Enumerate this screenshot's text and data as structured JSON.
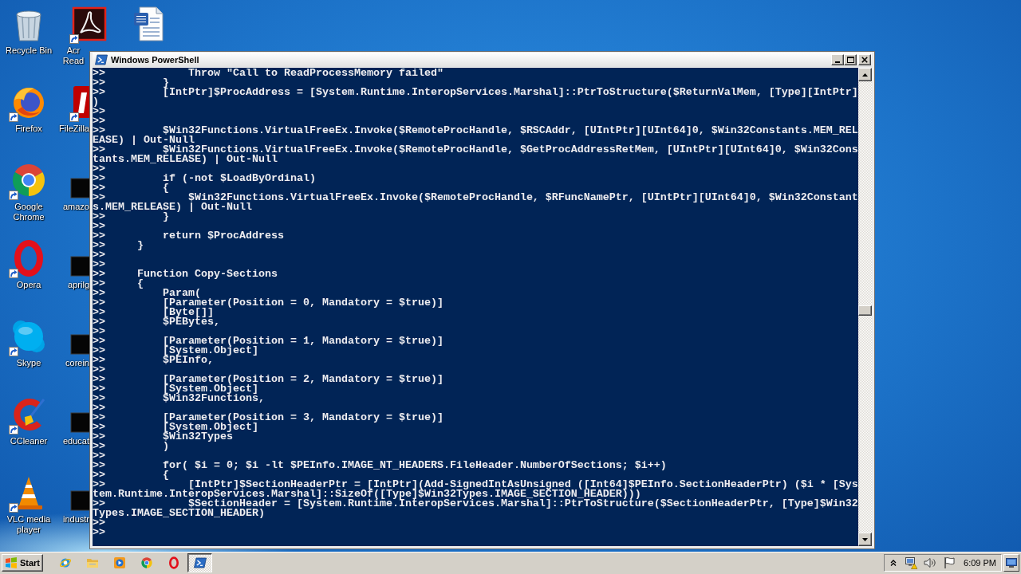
{
  "desktop": {
    "columns": [
      {
        "icons": [
          {
            "kind": "recycle_bin",
            "label": "Recycle Bin",
            "shortcut": false
          },
          {
            "kind": "firefox",
            "label": "Firefox",
            "shortcut": true
          },
          {
            "kind": "chrome",
            "label": "Google Chrome",
            "shortcut": true
          },
          {
            "kind": "opera",
            "label": "Opera",
            "shortcut": true
          },
          {
            "kind": "skype",
            "label": "Skype",
            "shortcut": true
          },
          {
            "kind": "ccleaner",
            "label": "CCleaner",
            "shortcut": true
          },
          {
            "kind": "vlc",
            "label": "VLC media player",
            "shortcut": true
          }
        ]
      },
      {
        "icons": [
          {
            "kind": "acrobat",
            "label": "Acr Read",
            "shortcut": true
          },
          {
            "kind": "filezilla",
            "label": "FileZilla",
            "shortcut": true
          },
          {
            "kind": "file",
            "label": "amazo",
            "shortcut": false
          },
          {
            "kind": "file",
            "label": "aprilg",
            "shortcut": false
          },
          {
            "kind": "file",
            "label": "corein",
            "shortcut": false
          },
          {
            "kind": "file",
            "label": "educat",
            "shortcut": false
          },
          {
            "kind": "file",
            "label": "industr",
            "shortcut": false
          }
        ]
      },
      {
        "icons": [
          {
            "kind": "word_document",
            "shortcut": false
          }
        ]
      }
    ]
  },
  "window": {
    "title": "Windows PowerShell",
    "console_lines": [
      ">>             Throw \"Call to ReadProcessMemory failed\"",
      ">>         }",
      ">>         [IntPtr]$ProcAddress = [System.Runtime.InteropServices.Marshal]::PtrToStructure($ReturnValMem, [Type][IntPtr]",
      ")",
      ">>",
      ">>",
      ">>         $Win32Functions.VirtualFreeEx.Invoke($RemoteProcHandle, $RSCAddr, [UIntPtr][UInt64]0, $Win32Constants.MEM_REL",
      "EASE) | Out-Null",
      ">>         $Win32Functions.VirtualFreeEx.Invoke($RemoteProcHandle, $GetProcAddressRetMem, [UIntPtr][UInt64]0, $Win32Cons",
      "tants.MEM_RELEASE) | Out-Null",
      ">>",
      ">>         if (-not $LoadByOrdinal)",
      ">>         {",
      ">>             $Win32Functions.VirtualFreeEx.Invoke($RemoteProcHandle, $RFuncNamePtr, [UIntPtr][UInt64]0, $Win32Constant",
      "s.MEM_RELEASE) | Out-Null",
      ">>         }",
      ">>",
      ">>         return $ProcAddress",
      ">>     }",
      ">>",
      ">>",
      ">>     Function Copy-Sections",
      ">>     {",
      ">>         Param(",
      ">>         [Parameter(Position = 0, Mandatory = $true)]",
      ">>         [Byte[]]",
      ">>         $PEBytes,",
      ">>",
      ">>         [Parameter(Position = 1, Mandatory = $true)]",
      ">>         [System.Object]",
      ">>         $PEInfo,",
      ">>",
      ">>         [Parameter(Position = 2, Mandatory = $true)]",
      ">>         [System.Object]",
      ">>         $Win32Functions,",
      ">>",
      ">>         [Parameter(Position = 3, Mandatory = $true)]",
      ">>         [System.Object]",
      ">>         $Win32Types",
      ">>         )",
      ">>",
      ">>         for( $i = 0; $i -lt $PEInfo.IMAGE_NT_HEADERS.FileHeader.NumberOfSections; $i++)",
      ">>         {",
      ">>             [IntPtr]$SectionHeaderPtr = [IntPtr](Add-SignedIntAsUnsigned ([Int64]$PEInfo.SectionHeaderPtr) ($i * [Sys",
      "tem.Runtime.InteropServices.Marshal]::SizeOf([Type]$Win32Types.IMAGE_SECTION_HEADER)))",
      ">>             $SectionHeader = [System.Runtime.InteropServices.Marshal]::PtrToStructure($SectionHeaderPtr, [Type]$Win32",
      "Types.IMAGE_SECTION_HEADER)",
      ">>",
      ">>"
    ]
  },
  "taskbar": {
    "start_label": "Start",
    "quick_launch": [
      {
        "kind": "ie"
      },
      {
        "kind": "explorer"
      },
      {
        "kind": "media_player"
      },
      {
        "kind": "chrome"
      },
      {
        "kind": "opera"
      }
    ],
    "tasks": [
      {
        "kind": "powershell",
        "selected": true
      }
    ],
    "tray": {
      "clock": "6:09 PM"
    }
  }
}
